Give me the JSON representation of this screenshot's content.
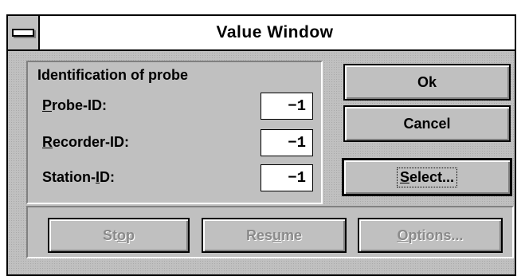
{
  "window": {
    "title": "Value Window"
  },
  "group": {
    "title": "Identification of probe",
    "fields": [
      {
        "label_pre": "",
        "label_key": "P",
        "label_post": "robe-ID:",
        "value": "−1"
      },
      {
        "label_pre": "",
        "label_key": "R",
        "label_post": "ecorder-ID:",
        "value": "−1"
      },
      {
        "label_pre": "Station-",
        "label_key": "I",
        "label_post": "D:",
        "value": "−1"
      }
    ]
  },
  "buttons": {
    "ok": "Ok",
    "cancel": "Cancel",
    "select": {
      "pre": "",
      "key": "S",
      "post": "elect..."
    },
    "stop": {
      "pre": "St",
      "key": "o",
      "post": "p"
    },
    "resume": {
      "pre": "Res",
      "key": "u",
      "post": "me"
    },
    "options": {
      "pre": "",
      "key": "O",
      "post": "ptions..."
    }
  }
}
